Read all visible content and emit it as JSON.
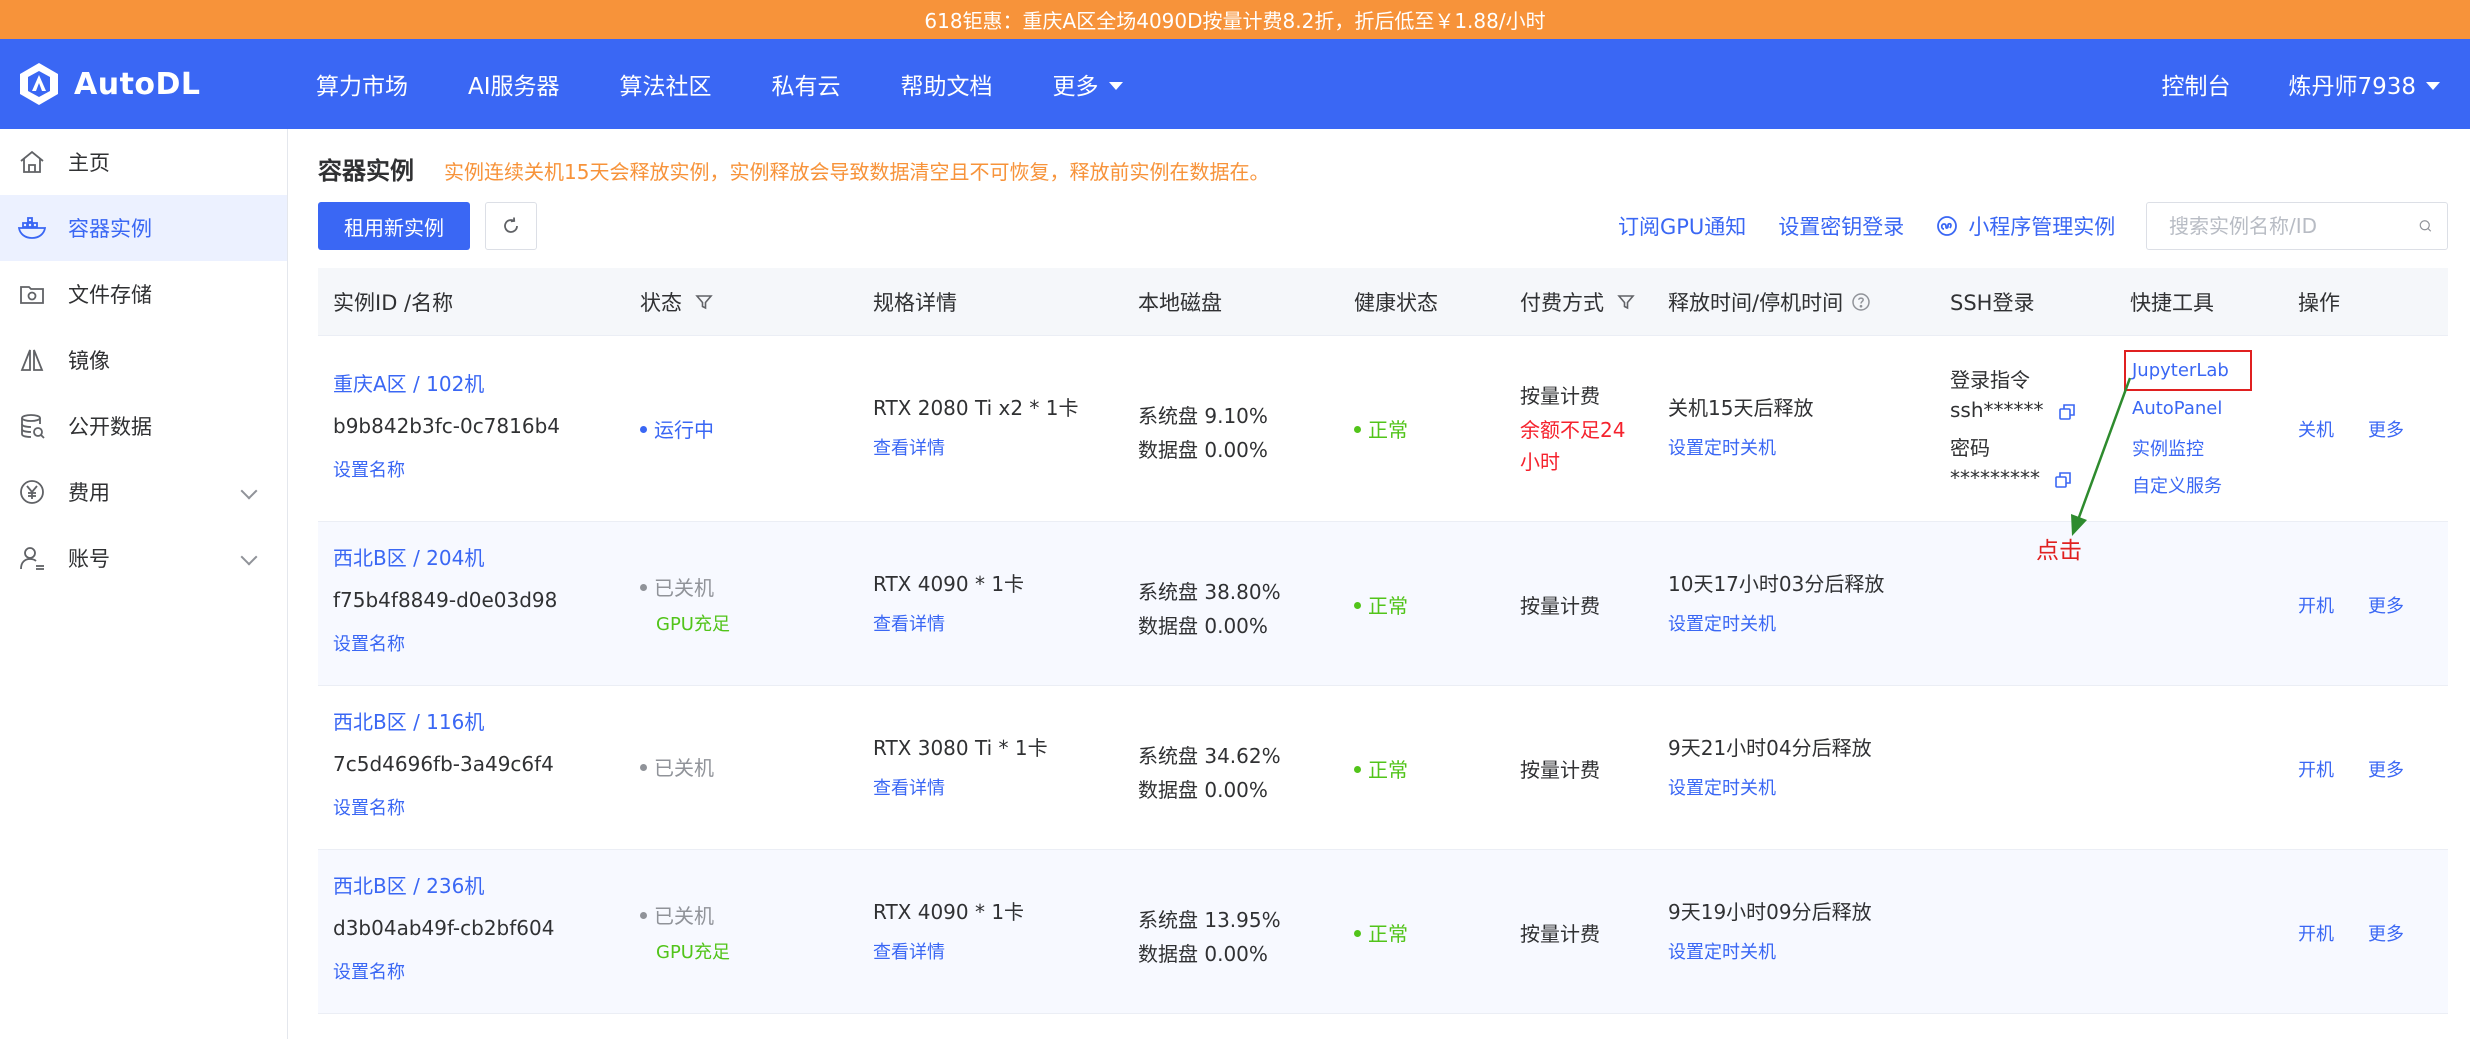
{
  "promo": {
    "text": "618钜惠：重庆A区全场4090D按量计费8.2折，折后低至￥1.88/小时"
  },
  "brand": {
    "name": "AutoDL",
    "color": "#3a67f4"
  },
  "nav": {
    "items": [
      "算力市场",
      "AI服务器",
      "算法社区",
      "私有云",
      "帮助文档",
      "更多"
    ],
    "console": "控制台",
    "user": "炼丹师7938"
  },
  "sidebar": {
    "items": [
      {
        "label": "主页",
        "icon": "home-icon"
      },
      {
        "label": "容器实例",
        "icon": "container-icon",
        "active": true
      },
      {
        "label": "文件存储",
        "icon": "folder-icon"
      },
      {
        "label": "镜像",
        "icon": "mirror-icon"
      },
      {
        "label": "公开数据",
        "icon": "database-icon"
      },
      {
        "label": "费用",
        "icon": "yen-icon",
        "expandable": true
      },
      {
        "label": "账号",
        "icon": "user-icon",
        "expandable": true
      }
    ]
  },
  "page": {
    "title": "容器实例",
    "warning": "实例连续关机15天会释放实例，实例释放会导致数据清空且不可恢复，释放前实例在数据在。"
  },
  "toolbar": {
    "rent_button": "租用新实例",
    "subscribe_link": "订阅GPU通知",
    "key_link": "设置密钥登录",
    "miniapp_link": "小程序管理实例",
    "search_placeholder": "搜索实例名称/ID"
  },
  "table": {
    "headers": {
      "id": "实例ID /名称",
      "status": "状态",
      "spec": "规格详情",
      "disk": "本地磁盘",
      "health": "健康状态",
      "billing": "付费方式",
      "release": "释放时间/停机时间",
      "ssh": "SSH登录",
      "tools": "快捷工具",
      "ops": "操作"
    },
    "rows": [
      {
        "name": "重庆A区 / 102机",
        "id": "b9b842b3fc-0c7816b4",
        "set_name": "设置名称",
        "status": "运行中",
        "status_sub": "",
        "spec": "RTX 2080 Ti x2 * 1卡",
        "spec_link": "查看详情",
        "sys_disk": "系统盘 9.10%",
        "data_disk": "数据盘 0.00%",
        "health": "正常",
        "billing": "按量计费",
        "billing_warn_1": "余额不足24",
        "billing_warn_2": "小时",
        "release": "关机15天后释放",
        "release_link": "设置定时关机",
        "ssh_cmd_label": "登录指令",
        "ssh_cmd": "ssh******",
        "ssh_pwd_label": "密码",
        "ssh_pwd": "*********",
        "tools": [
          "JupyterLab",
          "AutoPanel",
          "实例监控",
          "自定义服务"
        ],
        "op1": "关机",
        "op2": "更多"
      },
      {
        "name": "西北B区 / 204机",
        "id": "f75b4f8849-d0e03d98",
        "set_name": "设置名称",
        "status": "已关机",
        "status_sub": "GPU充足",
        "spec": "RTX 4090 * 1卡",
        "spec_link": "查看详情",
        "sys_disk": "系统盘 38.80%",
        "data_disk": "数据盘 0.00%",
        "health": "正常",
        "billing": "按量计费",
        "release": "10天17小时03分后释放",
        "release_link": "设置定时关机",
        "op1": "开机",
        "op2": "更多"
      },
      {
        "name": "西北B区 / 116机",
        "id": "7c5d4696fb-3a49c6f4",
        "set_name": "设置名称",
        "status": "已关机",
        "status_sub": "",
        "spec": "RTX 3080 Ti * 1卡",
        "spec_link": "查看详情",
        "sys_disk": "系统盘 34.62%",
        "data_disk": "数据盘 0.00%",
        "health": "正常",
        "billing": "按量计费",
        "release": "9天21小时04分后释放",
        "release_link": "设置定时关机",
        "op1": "开机",
        "op2": "更多"
      },
      {
        "name": "西北B区 / 236机",
        "id": "d3b04ab49f-cb2bf604",
        "set_name": "设置名称",
        "status": "已关机",
        "status_sub": "GPU充足",
        "spec": "RTX 4090 * 1卡",
        "spec_link": "查看详情",
        "sys_disk": "系统盘 13.95%",
        "data_disk": "数据盘 0.00%",
        "health": "正常",
        "billing": "按量计费",
        "release": "9天19小时09分后释放",
        "release_link": "设置定时关机",
        "op1": "开机",
        "op2": "更多"
      }
    ]
  },
  "annotation": {
    "text": "点击",
    "color": "#e02020"
  }
}
